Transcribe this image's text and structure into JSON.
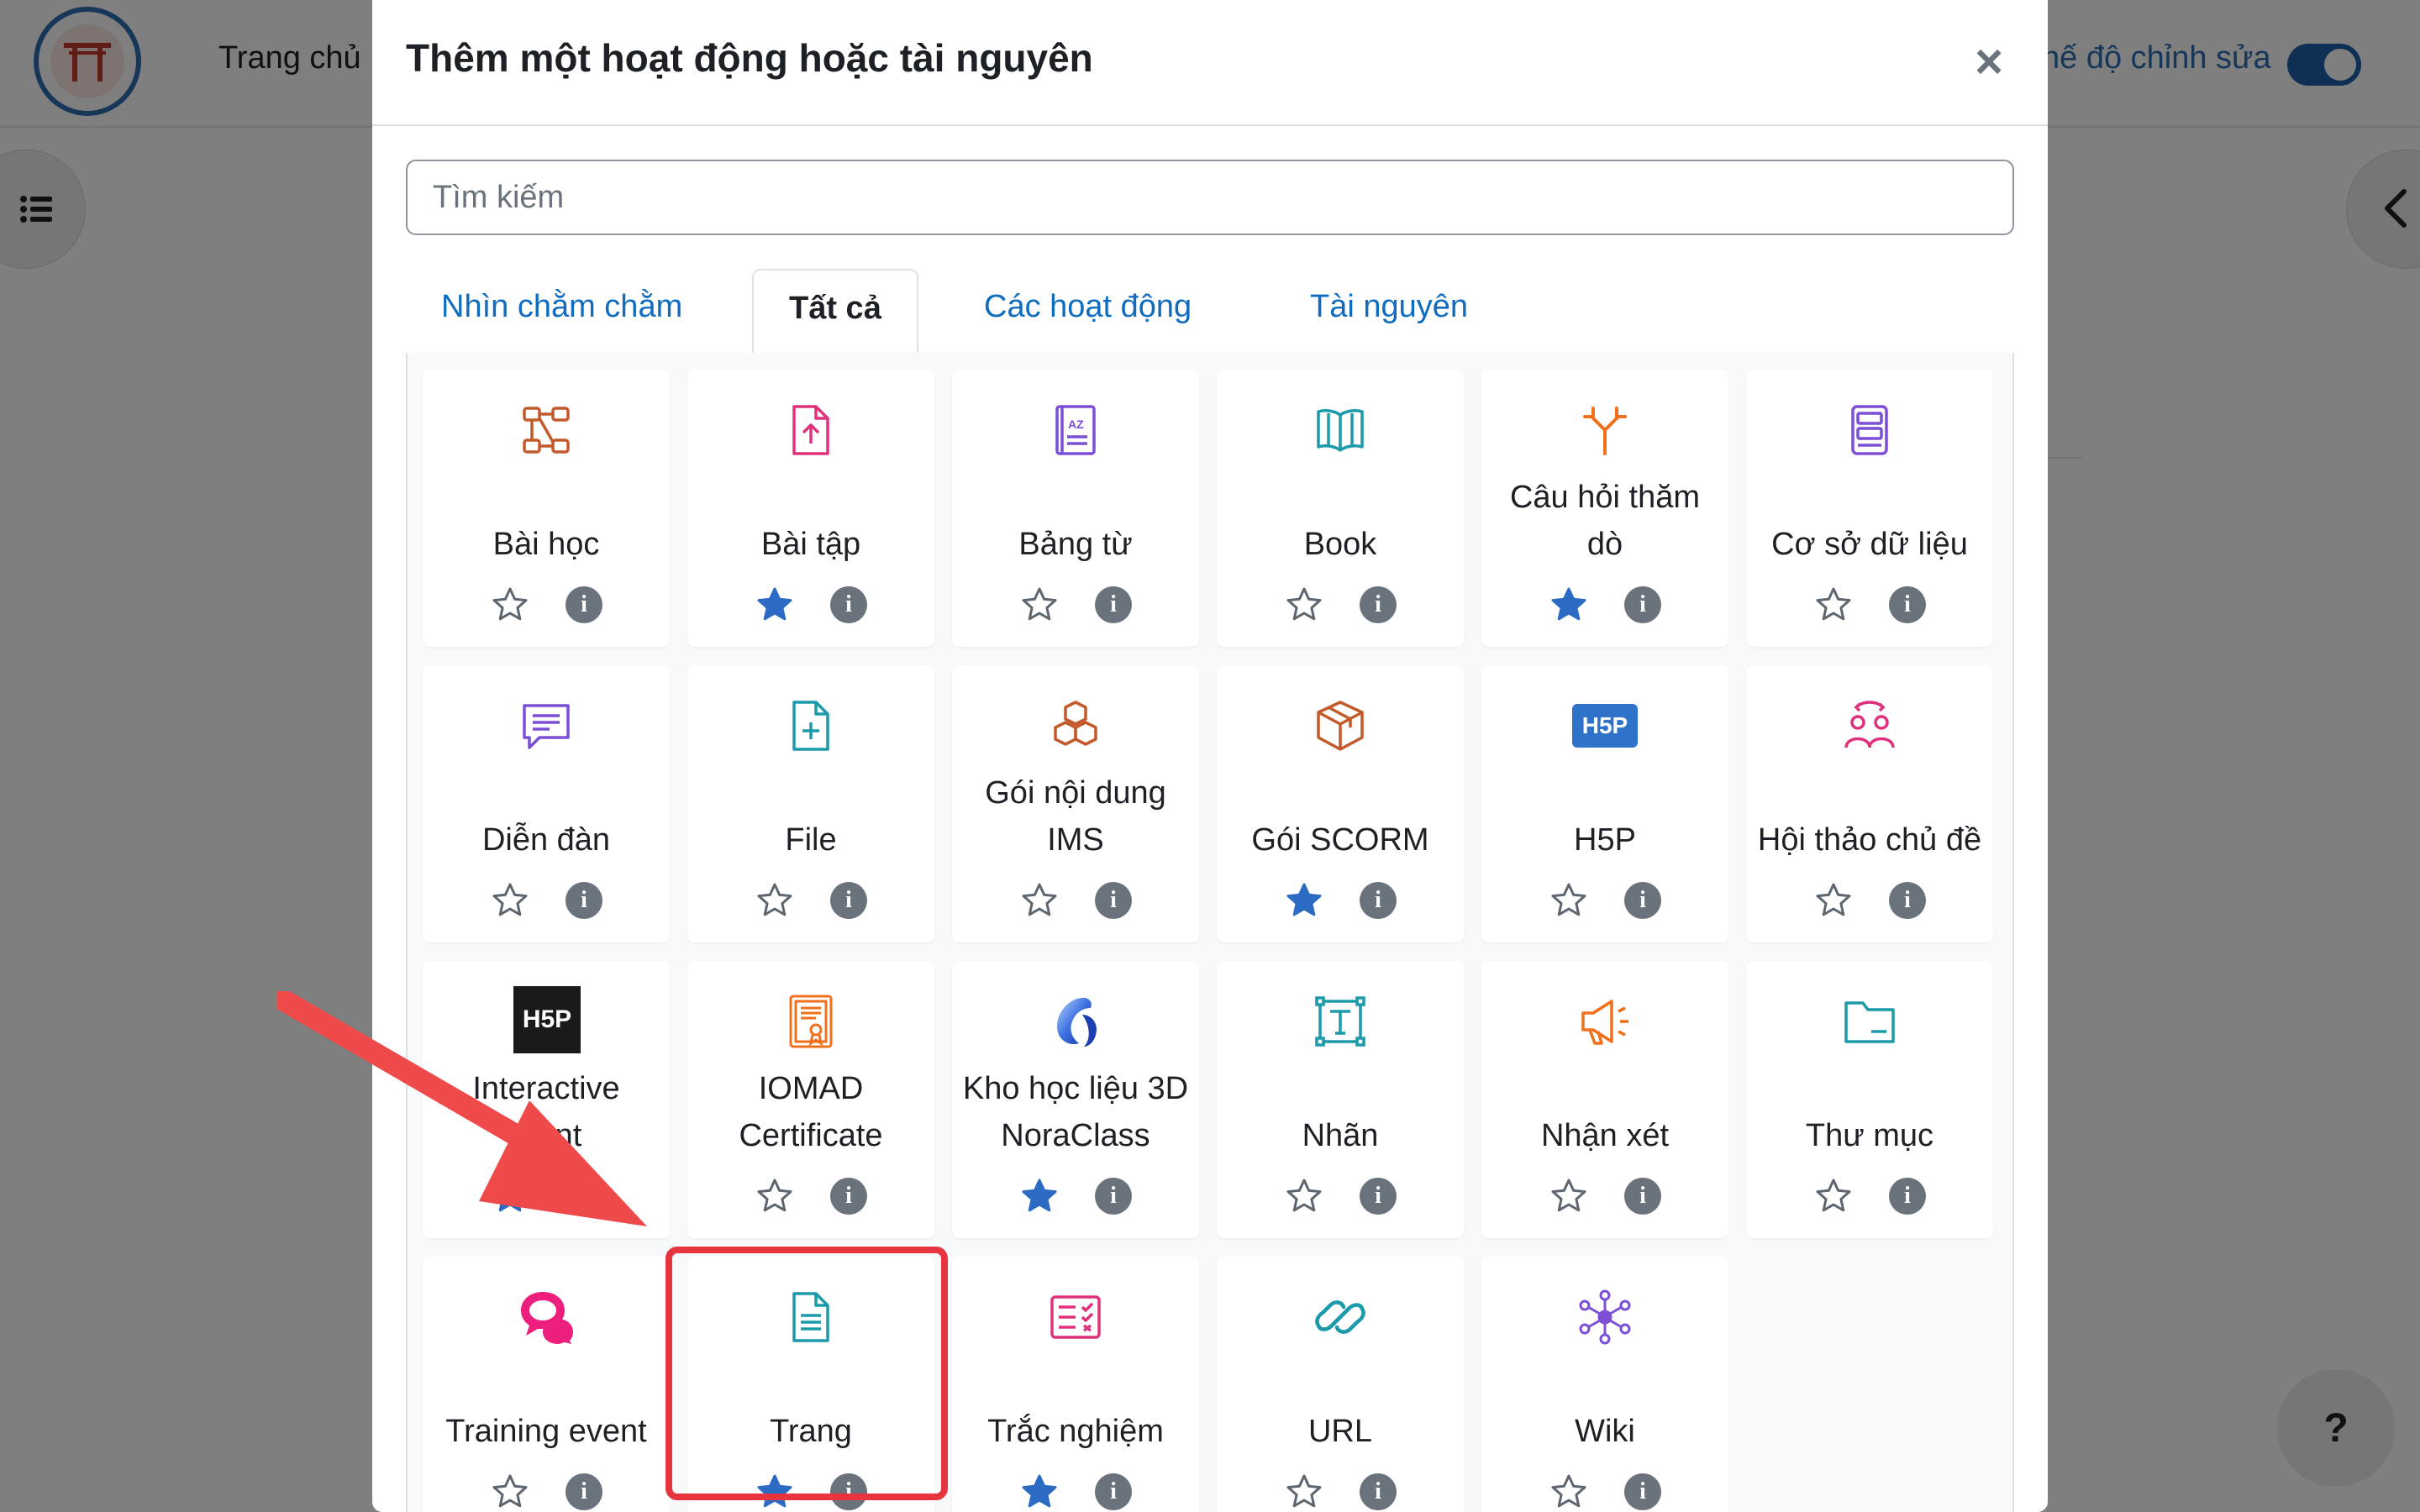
{
  "header": {
    "home_link": "Trang chủ",
    "edit_mode_label": "hế độ chỉnh sửa"
  },
  "help_button": "?",
  "modal": {
    "title": "Thêm một hoạt động hoặc tài nguyên",
    "close_symbol": "×",
    "search_placeholder": "Tìm kiếm",
    "tabs": [
      "Nhìn chằm chằm",
      "Tất cả",
      "Các hoạt động",
      "Tài nguyên"
    ],
    "active_tab": "Tất cả",
    "items": [
      {
        "line1": "Bài học",
        "line2": "",
        "icon": "lesson-icon",
        "starred": false
      },
      {
        "line1": "Bài tập",
        "line2": "",
        "icon": "assignment-upload-icon",
        "starred": true
      },
      {
        "line1": "Bảng từ",
        "line2": "",
        "icon": "glossary-icon",
        "starred": false
      },
      {
        "line1": "Book",
        "line2": "",
        "icon": "book-icon",
        "starred": false
      },
      {
        "line1": "Câu hỏi thăm",
        "line2": "dò",
        "icon": "choice-icon",
        "starred": true
      },
      {
        "line1": "Cơ sở dữ liệu",
        "line2": "",
        "icon": "database-icon",
        "starred": false
      },
      {
        "line1": "Diễn đàn",
        "line2": "",
        "icon": "forum-icon",
        "starred": false
      },
      {
        "line1": "File",
        "line2": "",
        "icon": "file-icon",
        "starred": false
      },
      {
        "line1": "Gói nội dung",
        "line2": "IMS",
        "icon": "ims-package-icon",
        "starred": false
      },
      {
        "line1": "Gói SCORM",
        "line2": "",
        "icon": "scorm-package-icon",
        "starred": true
      },
      {
        "line1": "H5P",
        "line2": "",
        "icon": "h5p-icon",
        "starred": false
      },
      {
        "line1": "Hội thảo chủ đề",
        "line2": "",
        "icon": "workshop-icon",
        "starred": false
      },
      {
        "line1": "Interactive",
        "line2": "ntent",
        "icon": "interactive-content-icon",
        "starred": true
      },
      {
        "line1": "IOMAD",
        "line2": "Certificate",
        "icon": "certificate-icon",
        "starred": false
      },
      {
        "line1": "Kho học liệu 3D",
        "line2": "NoraClass",
        "icon": "noraclass-icon",
        "starred": true
      },
      {
        "line1": "Nhãn",
        "line2": "",
        "icon": "label-icon",
        "starred": false
      },
      {
        "line1": "Nhận xét",
        "line2": "",
        "icon": "feedback-icon",
        "starred": false
      },
      {
        "line1": "Thư mục",
        "line2": "",
        "icon": "folder-icon",
        "starred": false
      },
      {
        "line1": "Training event",
        "line2": "",
        "icon": "training-event-icon",
        "starred": false
      },
      {
        "line1": "Trang",
        "line2": "",
        "icon": "page-icon",
        "starred": true
      },
      {
        "line1": "Trắc nghiệm",
        "line2": "",
        "icon": "quiz-icon",
        "starred": true
      },
      {
        "line1": "URL",
        "line2": "",
        "icon": "url-icon",
        "starred": false
      },
      {
        "line1": "Wiki",
        "line2": "",
        "icon": "wiki-icon",
        "starred": false
      }
    ],
    "h5p_badge": "H5P",
    "info_glyph": "i"
  },
  "colors": {
    "star_filled": "#2c6bc3",
    "star_outline": "#5d6670",
    "highlight": "#e8343f",
    "arrow": "#ef4a4a",
    "link": "#0f6cbf"
  }
}
